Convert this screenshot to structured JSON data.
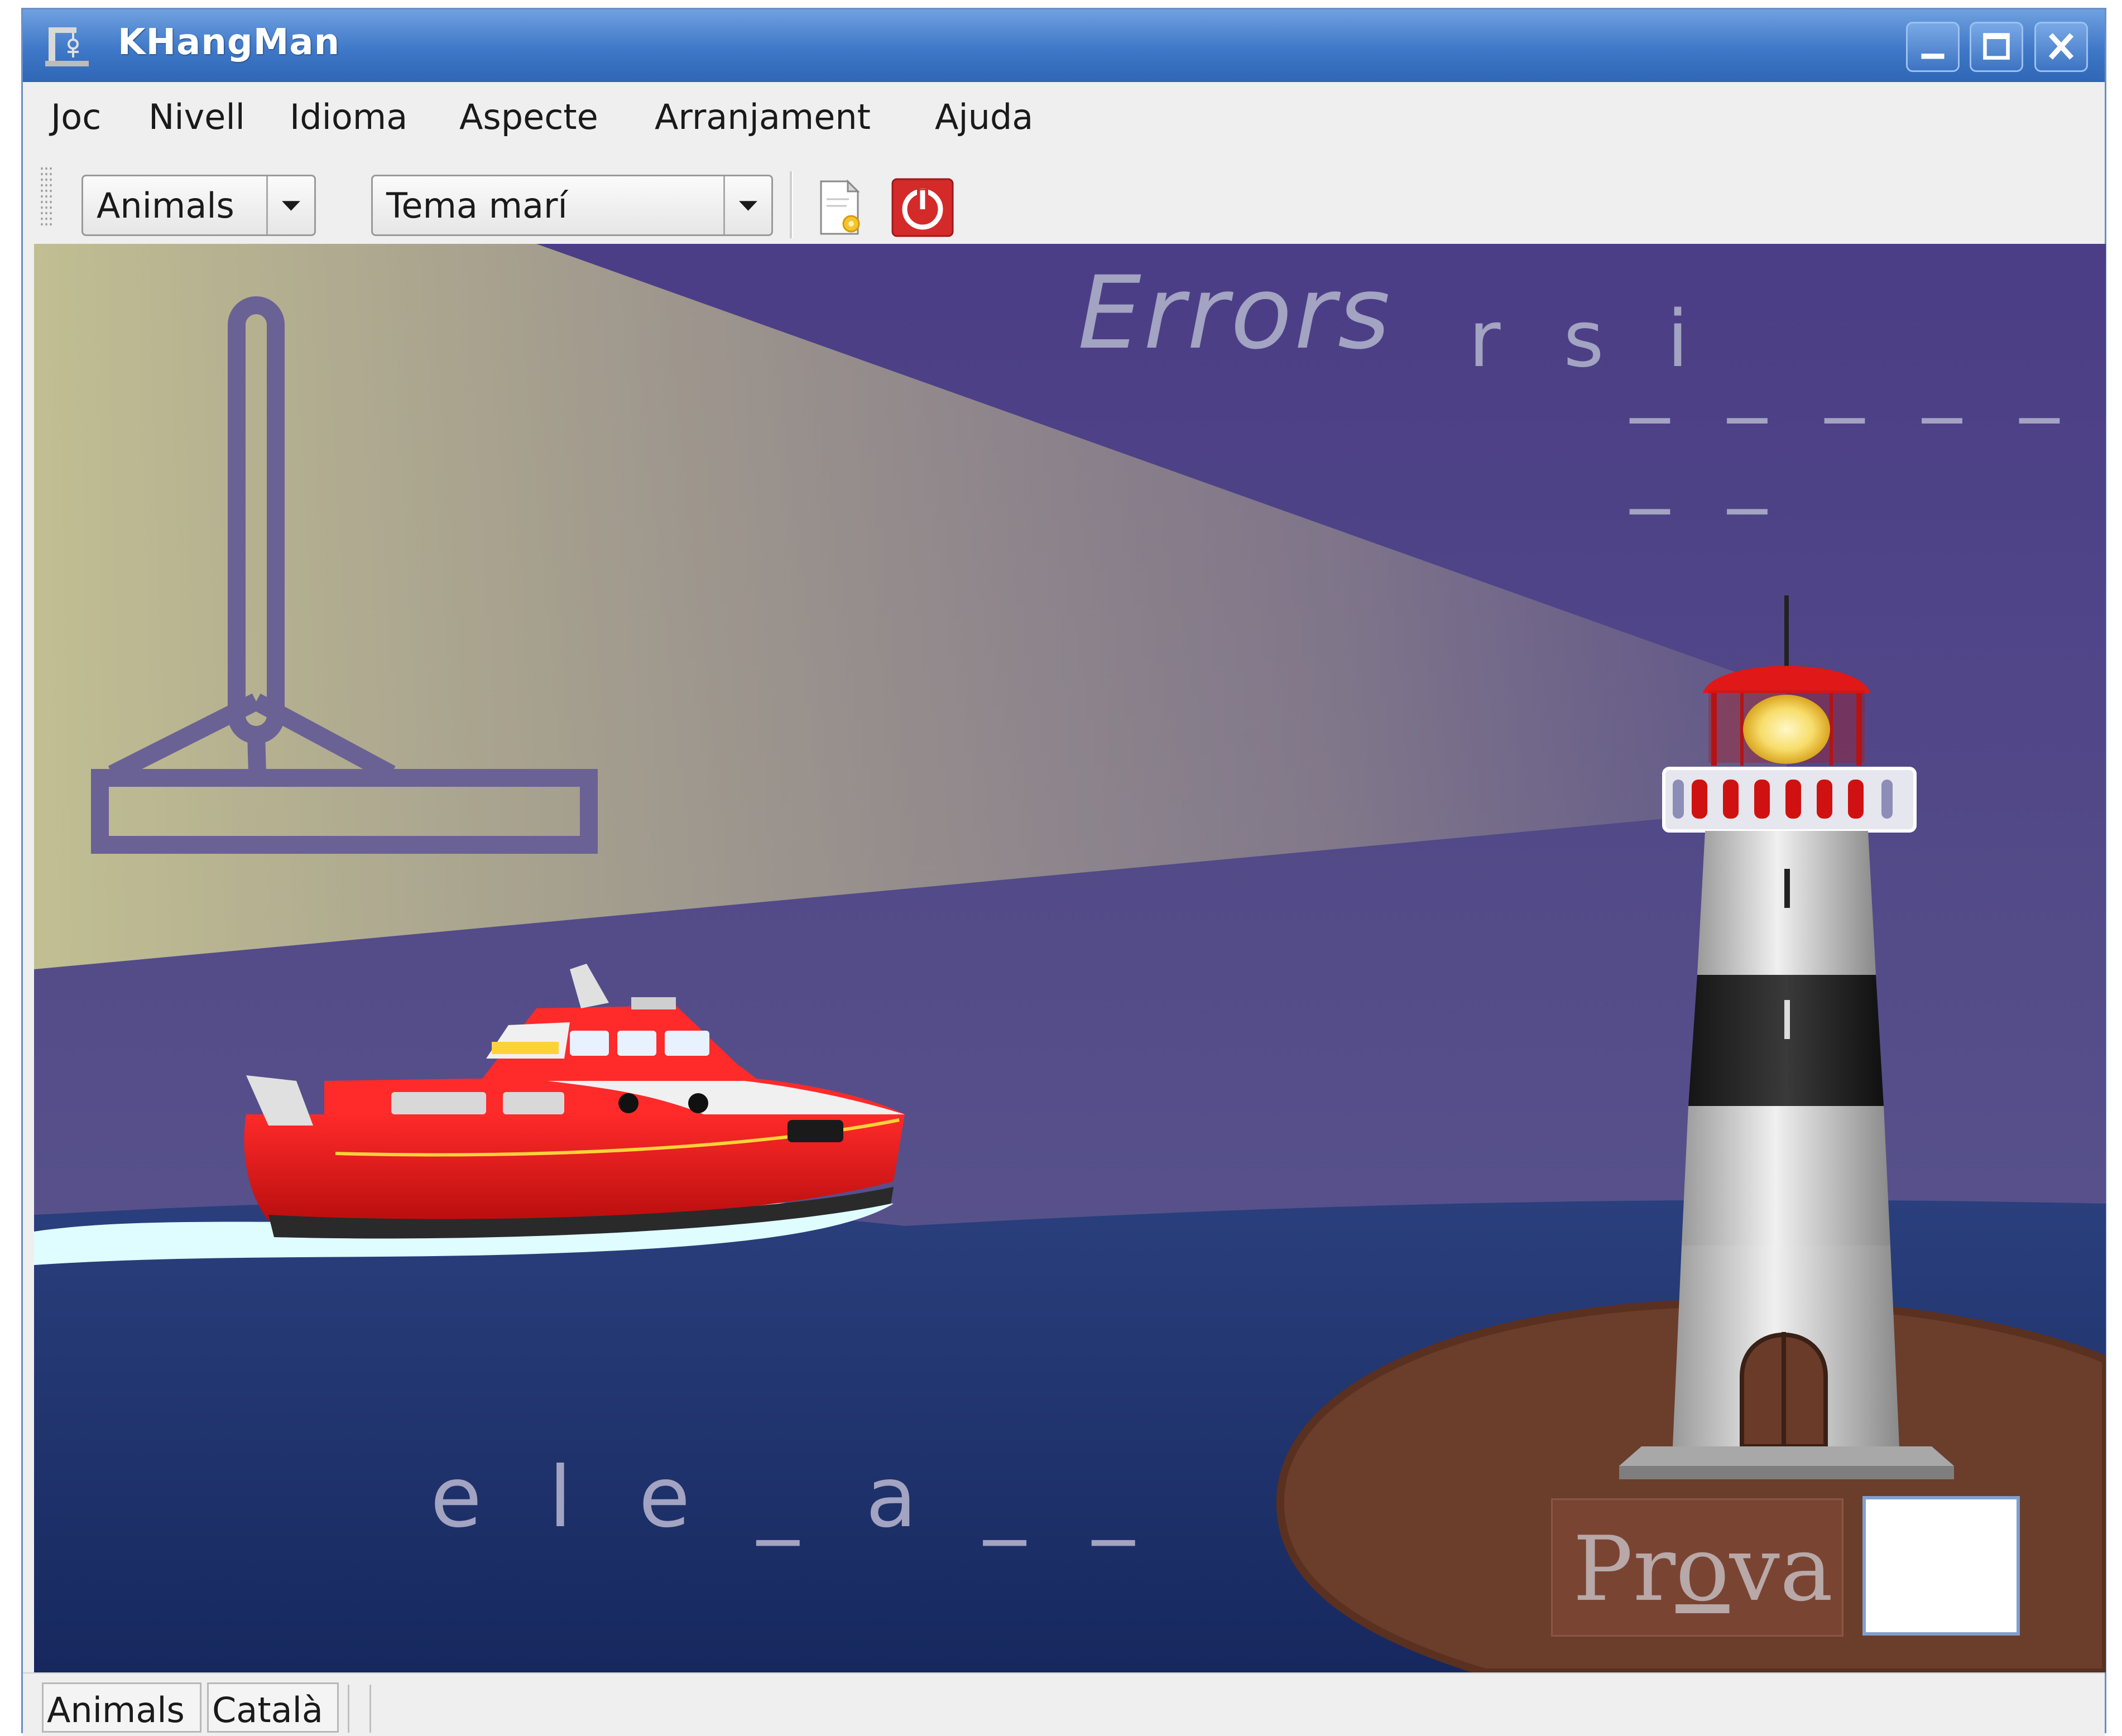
{
  "window": {
    "title": "KHangMan",
    "controls": {
      "minimize": "minimize",
      "maximize": "maximize",
      "close": "close"
    }
  },
  "menubar": {
    "items": [
      {
        "label": "Joc"
      },
      {
        "label": "Nivell"
      },
      {
        "label": "Idioma"
      },
      {
        "label": "Aspecte"
      },
      {
        "label": "Arranjament"
      },
      {
        "label": "Ajuda"
      }
    ]
  },
  "toolbar": {
    "category_selected": "Animals",
    "theme_selected": "Tema marí",
    "new_icon": "new-document-icon",
    "quit_icon": "power-icon"
  },
  "game": {
    "errors_label": "Errors",
    "missed_letters": "r s i",
    "missed_slots": "_ _ _ _ _ _ _",
    "word_pattern": "e l e _ a _ _",
    "guess_button_pre": "Pr",
    "guess_button_u": "o",
    "guess_button_post": "va",
    "guess_input_value": ""
  },
  "statusbar": {
    "level": "Animals",
    "language": "Català"
  },
  "colors": {
    "titlebar": "#3f78c8",
    "sky": "#4e3f86",
    "sea": "#1f3773",
    "island": "#6b3d2b",
    "beam": "#c9c79a",
    "hangman_gallows": "#6a6294",
    "text_ghost": "#a3a3c2"
  }
}
